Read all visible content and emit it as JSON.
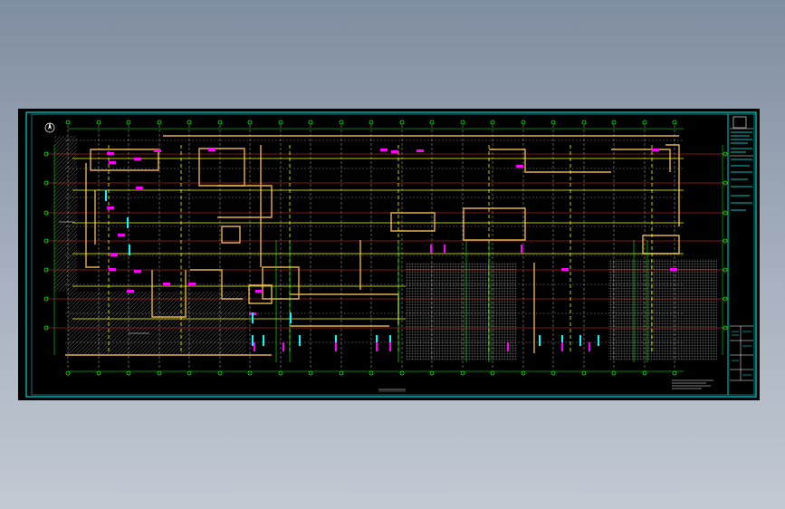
{
  "drawing": {
    "title": "",
    "background": "#000000",
    "colors": {
      "frame": "#00ffff",
      "grid": "#ffffff",
      "axis": "#ff2d2d",
      "wall": "#e3b04b",
      "pipe": "#ffff00",
      "marker": "#ff00ff",
      "bubble": "#00ff00",
      "equipment": "#00ffff"
    },
    "icons": [
      "north-arrow-icon",
      "grid-bubble-icon"
    ]
  }
}
